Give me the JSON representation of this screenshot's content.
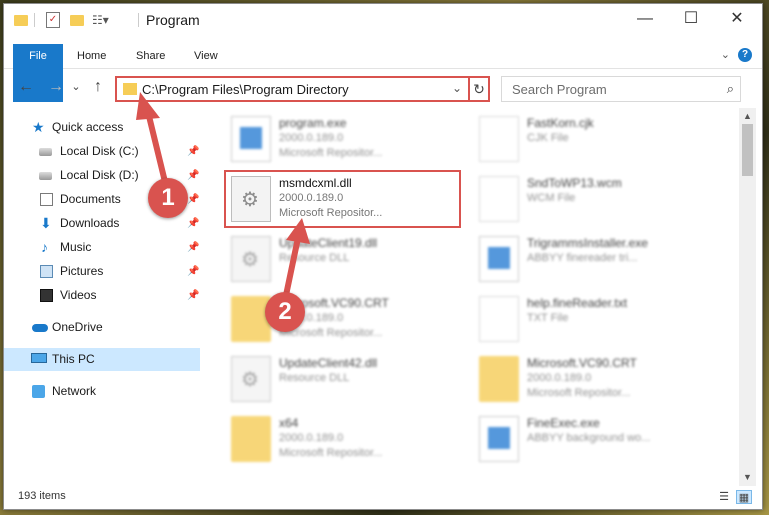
{
  "window": {
    "title": "Program",
    "minimize": "—",
    "maximize": "☐",
    "close": "✕"
  },
  "ribbon": {
    "tabs": [
      "File",
      "Home",
      "Share",
      "View"
    ],
    "help": "?",
    "collapse": "⌄"
  },
  "nav": {
    "back": "←",
    "forward": "→",
    "recent": "⌄",
    "up": "↑",
    "address": "C:\\Program Files\\Program Directory",
    "address_dropdown": "⌄",
    "refresh": "↻",
    "search_placeholder": "Search Program",
    "search_icon": "⌕"
  },
  "sidebar": {
    "items": [
      {
        "label": "Quick access",
        "icon": "star-icon"
      },
      {
        "label": "Local Disk (C:)",
        "icon": "drive-icon",
        "pinned": true
      },
      {
        "label": "Local Disk (D:)",
        "icon": "drive-icon",
        "pinned": true
      },
      {
        "label": "Documents",
        "icon": "documents-icon",
        "pinned": true
      },
      {
        "label": "Downloads",
        "icon": "downloads-icon",
        "pinned": true
      },
      {
        "label": "Music",
        "icon": "music-icon",
        "pinned": true
      },
      {
        "label": "Pictures",
        "icon": "pictures-icon",
        "pinned": true
      },
      {
        "label": "Videos",
        "icon": "videos-icon",
        "pinned": true
      },
      {
        "label": "OneDrive",
        "icon": "cloud-icon"
      },
      {
        "label": "This PC",
        "icon": "pc-icon",
        "selected": true
      },
      {
        "label": "Network",
        "icon": "network-icon"
      }
    ],
    "pin_glyph": "📌"
  },
  "files": [
    {
      "name": "program.exe",
      "line2": "2000.0.189.0",
      "line3": "Microsoft Repositor...",
      "thumb": "exe"
    },
    {
      "name": "FastKorn.cjk",
      "line2": "CJK File",
      "line3": "",
      "thumb": "doc"
    },
    {
      "name": "msmdcxml.dll",
      "line2": "2000.0.189.0",
      "line3": "Microsoft Repositor...",
      "thumb": "gear",
      "highlighted": true
    },
    {
      "name": "SndToWP13.wcm",
      "line2": "WCM File",
      "line3": "",
      "thumb": "doc"
    },
    {
      "name": "UpdateClient19.dll",
      "line2": "Resource DLL",
      "line3": "",
      "thumb": "gear"
    },
    {
      "name": "TrigrammsInstaller.exe",
      "line2": "ABBYY finereader tri...",
      "line3": "",
      "thumb": "exe"
    },
    {
      "name": "Microsoft.VC90.CRT",
      "line2": "2000.0.189.0",
      "line3": "Microsoft Repositor...",
      "thumb": "folder"
    },
    {
      "name": "help.fineReader.txt",
      "line2": "TXT File",
      "line3": "",
      "thumb": "doc"
    },
    {
      "name": "UpdateClient42.dll",
      "line2": "Resource DLL",
      "line3": "",
      "thumb": "gear"
    },
    {
      "name": "Microsoft.VC90.CRT",
      "line2": "2000.0.189.0",
      "line3": "Microsoft Repositor...",
      "thumb": "folder"
    },
    {
      "name": "x64",
      "line2": "2000.0.189.0",
      "line3": "Microsoft Repositor...",
      "thumb": "folder"
    },
    {
      "name": "FineExec.exe",
      "line2": "ABBYY background wo...",
      "line3": "",
      "thumb": "exe"
    }
  ],
  "status": {
    "count": "193 items"
  },
  "annotations": {
    "step1": "1",
    "step2": "2",
    "color": "#d9534f"
  }
}
